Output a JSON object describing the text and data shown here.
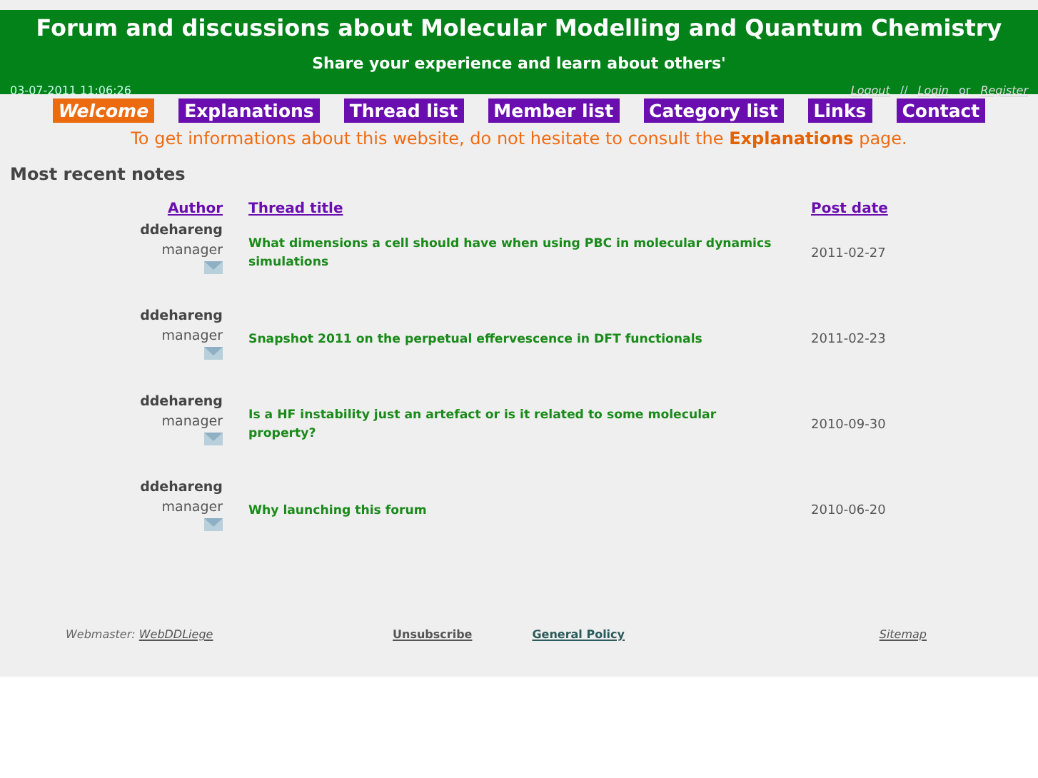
{
  "header": {
    "title": "Forum and discussions about Molecular Modelling and Quantum Chemistry",
    "subtitle": "Share your experience and learn about others'",
    "datetime": "03-07-2011 11:06:26",
    "account_links": [
      {
        "label": "Logout"
      },
      {
        "label": "//",
        "kind": "separator"
      },
      {
        "label": "Login"
      },
      {
        "label": "or",
        "kind": "separator"
      },
      {
        "label": "Register"
      }
    ]
  },
  "menu": [
    {
      "label": "Welcome",
      "selected": true
    },
    {
      "label": "Explanations",
      "selected": false
    },
    {
      "label": "Thread list",
      "selected": false
    },
    {
      "label": "Member list",
      "selected": false
    },
    {
      "label": "Category list",
      "selected": false
    },
    {
      "label": "Links",
      "selected": false
    },
    {
      "label": "Contact",
      "selected": false
    }
  ],
  "notice": "To get informations about this website, do not hesitate to consult the **Explanations** page.",
  "section_title": "Most recent notes",
  "table": {
    "columns": [
      "Author",
      "Thread title",
      "Post date"
    ],
    "rows": [
      {
        "author": "ddehareng",
        "role": "manager",
        "title": "What dimensions a cell should have when using PBC in molecular dynamics simulations",
        "date": "2011-02-27"
      },
      {
        "author": "ddehareng",
        "role": "manager",
        "title": "Snapshot 2011 on the perpetual effervescence in DFT functionals",
        "date": "2011-02-23"
      },
      {
        "author": "ddehareng",
        "role": "manager",
        "title": "Is a HF instability just an artefact or is it related to some molecular property?",
        "date": "2010-09-30"
      },
      {
        "author": "ddehareng",
        "role": "manager",
        "title": "Why launching this forum",
        "date": "2010-06-20"
      }
    ]
  },
  "footer": {
    "webmaster_label": "Webmaster:",
    "webmaster_link": "WebDDLiege",
    "links": [
      "Unsubscribe",
      "General Policy"
    ],
    "sitemap": "Sitemap"
  }
}
